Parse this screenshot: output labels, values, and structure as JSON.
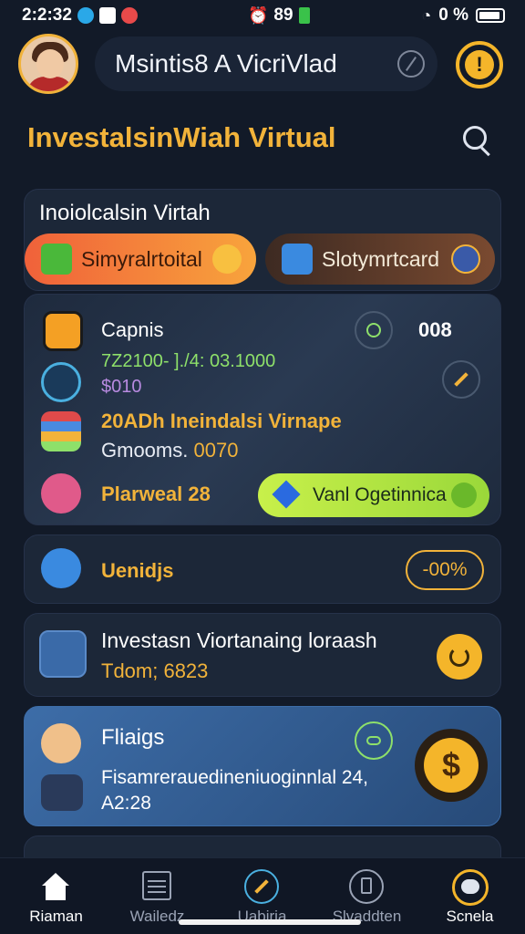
{
  "status": {
    "time": "2:2:32",
    "center": "89",
    "right": "0 %"
  },
  "header": {
    "username": "Msintis8 A VicriVlad"
  },
  "page_title": "InvestalsinWiah Virtual",
  "card1": {
    "title": "Inoiolcalsin Virtah",
    "btn_left": "Simyralrtoital",
    "btn_right": "Slotymrtcard"
  },
  "card2": {
    "row1": "Capnis",
    "row1_right": "008",
    "row2": "7Z2100- ]./4: 03.1000",
    "row2b": "$010",
    "row3": "20ADh Ineindalsi Virnape",
    "row3b_label": "Gmooms.",
    "row3b_value": "0070",
    "row4": "Plarweal 28",
    "cta": "Vanl Ogetinnica"
  },
  "card3": {
    "label": "Uenidjs",
    "value": "-00%"
  },
  "card4": {
    "title": "Investasn Viortanaing loraash",
    "sub": "Tdom; 6823"
  },
  "card5": {
    "title": "Fliaigs",
    "line1": "Fisamrerauedineniuoginnlal 24,",
    "line2": "A2:28"
  },
  "tabs": [
    {
      "label": "Riaman"
    },
    {
      "label": "Wailedz"
    },
    {
      "label": "Uabiria"
    },
    {
      "label": "Slvaddten"
    },
    {
      "label": "Scnela"
    }
  ],
  "colors": {
    "accent": "#f2b33a",
    "background": "#121a28",
    "card": "#1c2738"
  }
}
